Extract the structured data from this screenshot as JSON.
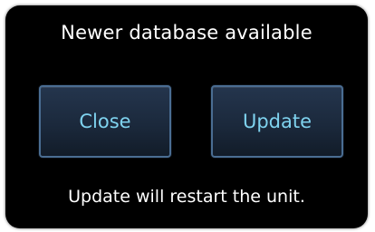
{
  "dialog": {
    "title": "Newer database available",
    "buttons": {
      "close_label": "Close",
      "update_label": "Update"
    },
    "message": "Update will restart the unit."
  },
  "colors": {
    "background": "#000000",
    "button_text": "#7fd3ef",
    "button_border": "#4a6d92",
    "text": "#ffffff"
  }
}
